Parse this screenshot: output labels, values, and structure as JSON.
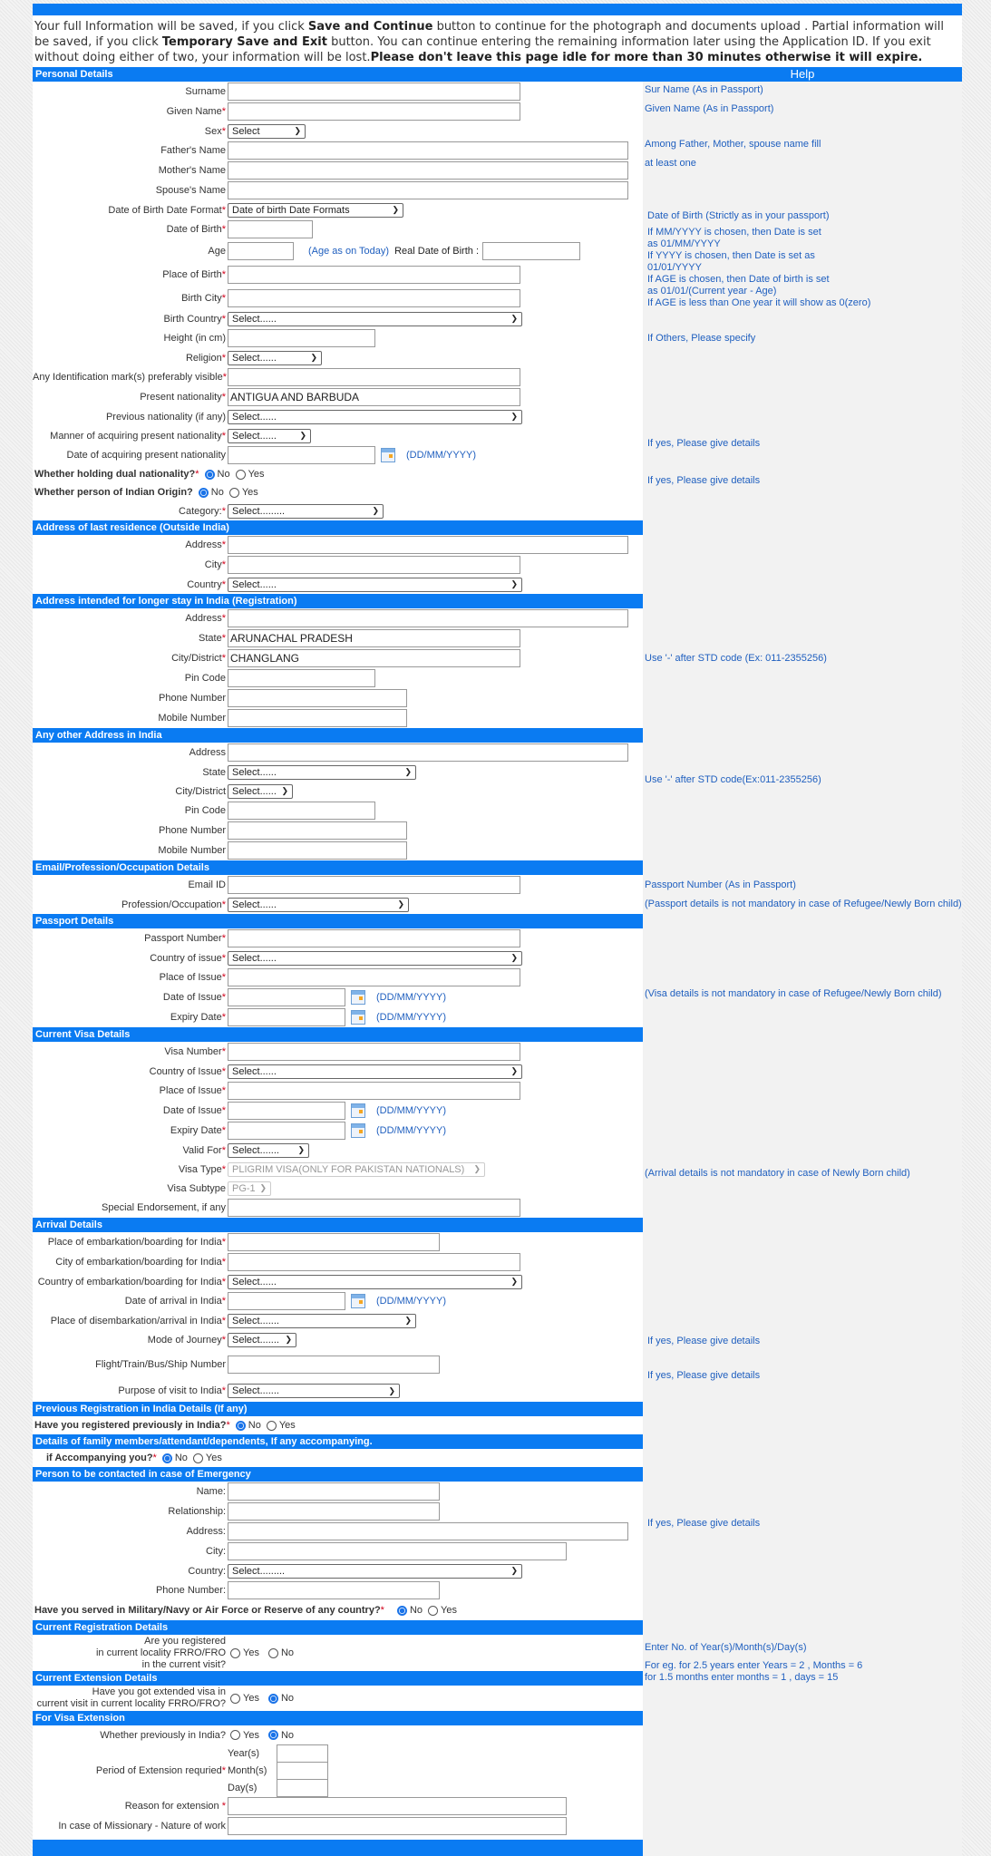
{
  "notice": {
    "p1": "Your full Information will be saved, if you click ",
    "save_continue": "Save and Continue",
    "p2": " button to continue for the photograph and documents upload . Partial information will be saved, if you click ",
    "temp_save": "Temporary Save and Exit",
    "p3": " button. You can continue entering the remaining information later using the Application ID. If you exit without doing either of two, your information will be lost.",
    "warning": "Please don't leave this page idle for more than 30 minutes otherwise it will expire."
  },
  "help_title": "Help",
  "sections": {
    "personal": "Personal Details",
    "last_residence": "Address of last residence (Outside India)",
    "longer_stay": "Address intended for longer stay in India (Registration)",
    "other_address": "Any other Address in India",
    "email": "Email/Profession/Occupation Details",
    "passport": "Passport Details",
    "visa": "Current Visa Details",
    "arrival": "Arrival Details",
    "prev_reg": "Previous Registration in India Details (If any)",
    "family": "Details of family members/attendant/dependents, If any accompanying.",
    "emergency": "Person to be contacted in case of Emergency",
    "curr_reg": "Current Registration Details",
    "curr_ext": "Current Extension Details",
    "visa_ext": "For Visa Extension"
  },
  "personal": {
    "surname": "Surname",
    "given_name": "Given Name",
    "sex": "Sex",
    "sex_value": "Select",
    "father": "Father's Name",
    "mother": "Mother's Name",
    "spouse": "Spouse's Name",
    "dob_format": "Date of Birth Date Format",
    "dob_format_value": "Date of birth Date Formats",
    "dob": "Date of Birth",
    "age": "Age",
    "age_note": "(Age as on Today)",
    "real_dob": "Real Date of Birth :",
    "place_birth": "Place of Birth",
    "birth_city": "Birth City",
    "birth_country": "Birth Country",
    "birth_country_value": "Select......",
    "height": "Height (in cm)",
    "religion": "Religion",
    "religion_value": "Select......",
    "id_mark": "Any Identification mark(s) preferably visible",
    "present_nat": "Present nationality",
    "present_nat_value": "ANTIGUA AND BARBUDA",
    "prev_nat": "Previous nationality (if any)",
    "prev_nat_value": "Select......",
    "manner": "Manner of acquiring present nationality",
    "manner_value": "Select......",
    "date_acq": "Date of acquiring present nationality",
    "date_fmt": "(DD/MM/YYYY)",
    "dual": "Whether holding dual nationality?",
    "indian_origin": "Whether person of Indian Origin?",
    "category": "Category:",
    "category_value": "Select.........",
    "no": "No",
    "yes": "Yes"
  },
  "last_res": {
    "address": "Address",
    "city": "City",
    "country": "Country",
    "country_value": "Select......"
  },
  "longer": {
    "address": "Address",
    "state": "State",
    "state_value": "ARUNACHAL PRADESH",
    "city": "City/District",
    "city_value": "CHANGLANG",
    "pin": "Pin Code",
    "phone": "Phone Number",
    "mobile": "Mobile Number"
  },
  "other": {
    "address": "Address",
    "state": "State",
    "state_value": "Select......",
    "city": "City/District",
    "city_value": "Select......",
    "pin": "Pin Code",
    "phone": "Phone Number",
    "mobile": "Mobile Number"
  },
  "email": {
    "email": "Email ID",
    "profession": "Profession/Occupation",
    "profession_value": "Select......"
  },
  "passport": {
    "number": "Passport Number",
    "country": "Country of issue",
    "country_value": "Select......",
    "place": "Place of Issue",
    "doi": "Date of Issue",
    "expiry": "Expiry Date"
  },
  "visa": {
    "number": "Visa Number",
    "country": "Country of Issue",
    "country_value": "Select......",
    "place": "Place of Issue",
    "doi": "Date of Issue",
    "expiry": "Expiry Date",
    "valid_for": "Valid For",
    "valid_for_value": "Select.......",
    "type": "Visa Type",
    "type_value": "PLIGRIM VISA(ONLY FOR PAKISTAN NATIONALS)",
    "subtype": "Visa Subtype",
    "subtype_value": "PG-1",
    "endorsement": "Special Endorsement, if any"
  },
  "arrival": {
    "place_emb": "Place of embarkation/boarding for India",
    "city_emb": "City of embarkation/boarding for India",
    "country_emb": "Country of embarkation/boarding for India",
    "country_emb_value": "Select......",
    "date_arr": "Date of arrival in India",
    "place_dis": "Place of disembarkation/arrival in India",
    "place_dis_value": "Select.......",
    "mode": "Mode of Journey",
    "mode_value": "Select.......",
    "flight": "Flight/Train/Bus/Ship Number",
    "purpose": "Purpose of visit to India",
    "purpose_value": "Select......."
  },
  "prev_reg": {
    "question": "Have you registered previously in India?"
  },
  "family": {
    "question": "if Accompanying you?"
  },
  "emergency": {
    "name": "Name:",
    "relationship": "Relationship:",
    "address": "Address:",
    "city": "City:",
    "country": "Country:",
    "country_value": "Select.........",
    "phone": "Phone Number:",
    "military": "Have you served in Military/Navy or Air Force or Reserve of any country?"
  },
  "curr_reg": {
    "q1": "Are you registered",
    "q2": "in current locality FRRO/FRO",
    "q3": "in the current visit?"
  },
  "curr_ext": {
    "q1": "Have you got extended visa in",
    "q2": "current visit in current locality FRRO/FRO?"
  },
  "visa_ext": {
    "prev_india": "Whether previously in India?",
    "period": "Period of Extension requried",
    "years": "Year(s)",
    "months": "Month(s)",
    "days": "Day(s)",
    "reason": "Reason for extension ",
    "missionary": "In case of Missionary - Nature of work"
  },
  "help": {
    "surname": "Sur Name (As in Passport)",
    "given": "Given Name (As in Passport)",
    "among": "Among Father, Mother, spouse name fill",
    "atleast": "at least one",
    "dob": "Date of Birth (Strictly as in your passport)",
    "mm1": "If MM/YYYY is chosen, then Date is set",
    "mm2": "as 01/MM/YYYY",
    "yy1": "If YYYY is chosen, then Date is set as",
    "yy2": "01/01/YYYY",
    "age1": "If AGE is chosen, then Date of birth is set",
    "age2": "as 01/01/(Current year - Age)",
    "age3": "If AGE is less than One year it will show as 0(zero)",
    "religion": "If Others, Please specify",
    "dual": "If yes, Please give details",
    "origin": "If yes, Please give details",
    "phone1": "Use '-' after STD code (Ex: 011-2355256)",
    "phone2": "Use '-' after STD code(Ex:011-2355256)",
    "passport1": "Passport Number (As in Passport)",
    "passport2": "(Passport details is not mandatory in case of Refugee/Newly Born child)",
    "visa": "(Visa details is not mandatory in case of Refugee/Newly Born child)",
    "arrival": "(Arrival details is not mandatory in case of Newly Born child)",
    "prev_reg": "If yes, Please give details",
    "family": "If yes, Please give details",
    "military": "If yes, Please give details",
    "ext1": "Enter No. of Year(s)/Month(s)/Day(s)",
    "ext2": "For eg. for 2.5 years enter Years = 2 , Months = 6",
    "ext3": "for 1.5 months enter months = 1 , days = 15"
  }
}
